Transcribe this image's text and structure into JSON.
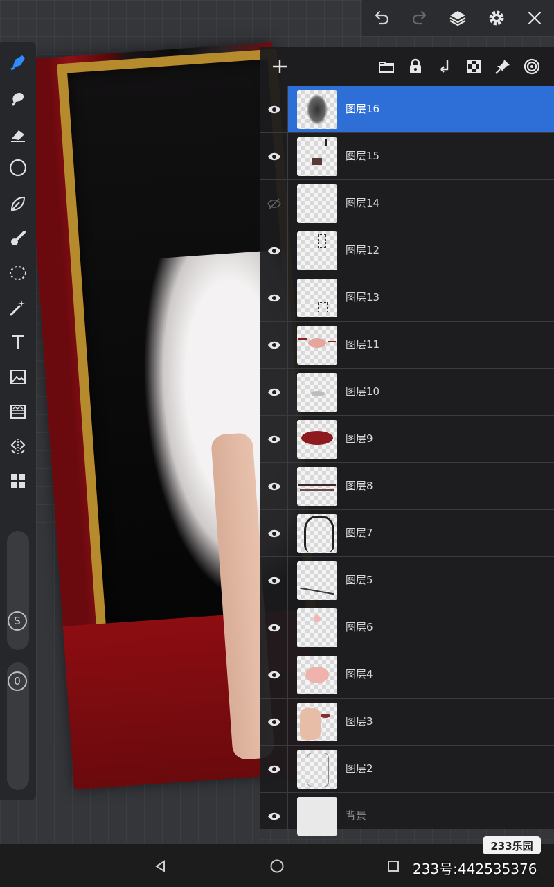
{
  "toolbar": {
    "undo_icon": "undo-icon",
    "redo_icon": "redo-icon",
    "layers_icon": "layers-icon",
    "settings_icon": "gear-icon",
    "close_icon": "close-icon"
  },
  "tools": [
    {
      "name": "brush-tool",
      "icon": "brush-icon",
      "active": true
    },
    {
      "name": "smudge-tool",
      "icon": "smudge-icon"
    },
    {
      "name": "eraser-tool",
      "icon": "eraser-icon"
    },
    {
      "name": "shape-tool",
      "icon": "circle-icon"
    },
    {
      "name": "lasso-fill-tool",
      "icon": "leaf-icon"
    },
    {
      "name": "color-tool",
      "icon": "dropper-icon"
    },
    {
      "name": "selection-tool",
      "icon": "dashed-selection-icon"
    },
    {
      "name": "magic-wand-tool",
      "icon": "magic-wand-icon"
    },
    {
      "name": "text-tool",
      "icon": "text-icon"
    },
    {
      "name": "image-import-tool",
      "icon": "image-icon"
    },
    {
      "name": "adjust-tool",
      "icon": "adjust-icon"
    },
    {
      "name": "symmetry-tool",
      "icon": "symmetry-icon"
    },
    {
      "name": "more-tool",
      "icon": "grid-icon"
    }
  ],
  "sliders": {
    "size_label": "S",
    "opacity_label": "0"
  },
  "layers_panel": {
    "add_icon": "plus-icon",
    "header_icons": [
      "folder-icon",
      "lock-icon",
      "merge-down-icon",
      "transparency-icon",
      "pin-icon",
      "target-icon"
    ],
    "layers": [
      {
        "name": "图层16",
        "visible": true,
        "active": true
      },
      {
        "name": "图层15",
        "visible": true
      },
      {
        "name": "图层14",
        "visible": false
      },
      {
        "name": "图层12",
        "visible": true
      },
      {
        "name": "图层13",
        "visible": true
      },
      {
        "name": "图层11",
        "visible": true
      },
      {
        "name": "图层10",
        "visible": true
      },
      {
        "name": "图层9",
        "visible": true
      },
      {
        "name": "图层8",
        "visible": true
      },
      {
        "name": "图层7",
        "visible": true
      },
      {
        "name": "图层5",
        "visible": true
      },
      {
        "name": "图层6",
        "visible": true
      },
      {
        "name": "图层4",
        "visible": true
      },
      {
        "name": "图层3",
        "visible": true
      },
      {
        "name": "图层2",
        "visible": true
      }
    ],
    "background_layer": {
      "name": "背景",
      "visible": true
    }
  },
  "system_nav": {
    "back_icon": "back-triangle-icon",
    "home_icon": "home-circle-icon",
    "recents_icon": "recents-square-icon"
  },
  "watermark": {
    "logo": "233乐园",
    "id": "233号:442535376"
  },
  "colors": {
    "accent": "#2d6fd6",
    "panel": "#1c1c1e",
    "rail": "#26272a"
  }
}
